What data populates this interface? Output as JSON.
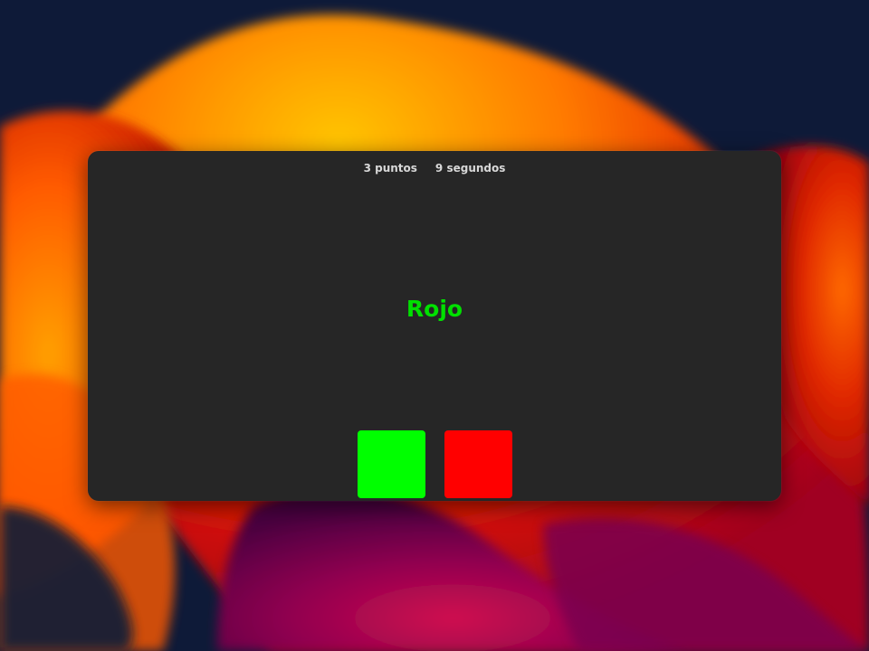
{
  "game": {
    "score_text": "3 puntos",
    "time_text": "9 segundos",
    "word": "Rojo",
    "word_color": "#00e000"
  },
  "choices": [
    {
      "color_name": "green",
      "color": "#00ff00"
    },
    {
      "color_name": "red",
      "color": "#ff0000"
    }
  ],
  "wallpaper": {
    "base": "#0e1a38",
    "accent_colors": [
      "#ffb000",
      "#ff6a00",
      "#e01000",
      "#b00030",
      "#7a0060"
    ]
  }
}
